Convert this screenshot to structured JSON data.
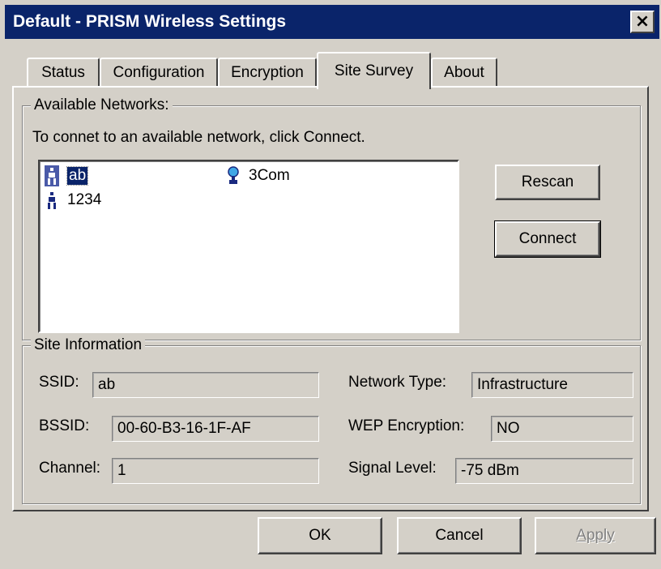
{
  "window": {
    "title": "Default - PRISM Wireless Settings",
    "close_glyph": "×"
  },
  "tabs": [
    {
      "label": "Status"
    },
    {
      "label": "Configuration"
    },
    {
      "label": "Encryption"
    },
    {
      "label": "Site Survey",
      "active": true
    },
    {
      "label": "About"
    }
  ],
  "available_networks": {
    "group_label": "Available Networks:",
    "hint": "To connet to an available network, click Connect.",
    "networks": [
      {
        "ssid": "ab",
        "icon": "adhoc-network-icon",
        "selected": true
      },
      {
        "ssid": "1234",
        "icon": "adhoc-network-icon",
        "selected": false
      },
      {
        "ssid": "3Com",
        "icon": "access-point-icon",
        "selected": false
      }
    ],
    "rescan_label": "Rescan",
    "connect_label": "Connect"
  },
  "site_information": {
    "group_label": "Site Information",
    "ssid_label": "SSID:",
    "ssid_value": "ab",
    "bssid_label": "BSSID:",
    "bssid_value": "00-60-B3-16-1F-AF",
    "channel_label": "Channel:",
    "channel_value": "1",
    "network_type_label": "Network Type:",
    "network_type_value": "Infrastructure",
    "wep_label": "WEP Encryption:",
    "wep_value": "NO",
    "signal_label": "Signal Level:",
    "signal_value": "-75 dBm"
  },
  "footer": {
    "ok_label": "OK",
    "cancel_label": "Cancel",
    "apply_label": "Apply"
  },
  "colors": {
    "title_bar": "#0a246a",
    "face": "#d4d0c8",
    "selection": "#0a246a"
  }
}
